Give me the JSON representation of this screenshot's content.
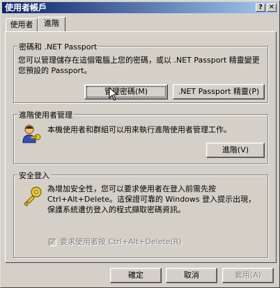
{
  "window": {
    "title": "使用者帳戶",
    "help_glyph": "?",
    "close_glyph": "✕"
  },
  "tabs": [
    {
      "label": "使用者"
    },
    {
      "label": "進階"
    }
  ],
  "passwords_group": {
    "legend": "密碼和 .NET Passport",
    "description": "您可以管理儲存在這個電腦上您的密碼，或以 .NET Passport 精靈變更您預設的 Passport。",
    "manage_button": "管理密碼(M)",
    "passport_button": ".NET Passport 精靈(P)"
  },
  "advanced_group": {
    "legend": "進階使用者管理",
    "description": "本機使用者和群組可以用來執行進階使用者管理工作。",
    "advanced_button": "進階(V)",
    "icon": "users-key-icon"
  },
  "secure_group": {
    "legend": "安全登入",
    "description": "為增加安全性，您可以要求使用者在登入前需先按 Ctrl+Alt+Delete。這保證可靠的 Windows 登入提示出現，保護系統遭仿登入的程式擷取密碼資訊。",
    "checkbox_label": "要求使用者按 Ctrl+Alt+Delete(R)",
    "checkbox_checked": true,
    "icon": "key-icon"
  },
  "footer": {
    "ok": "確定",
    "cancel": "取消",
    "apply": "套用(A)"
  }
}
